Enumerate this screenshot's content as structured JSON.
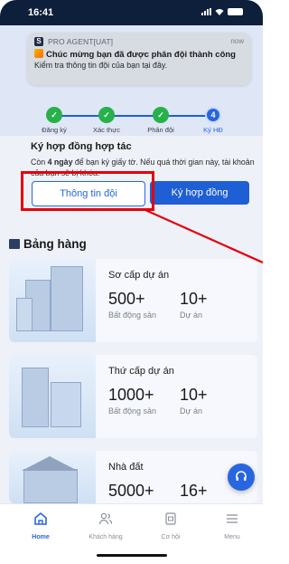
{
  "status_bar": {
    "time": "16:41"
  },
  "notification": {
    "app_name": "PRO AGENT[UAT]",
    "time": "now",
    "title": "Chúc mừng bạn đã được phân đội thành công",
    "body": "Kiểm tra thông tin đội của bạn tại đây."
  },
  "steps": [
    {
      "label": "Đăng ký",
      "state": "done"
    },
    {
      "label": "Xác thực",
      "state": "done"
    },
    {
      "label": "Phân đội",
      "state": "done"
    },
    {
      "label": "Ký HĐ",
      "state": "active",
      "number": "4"
    }
  ],
  "contract_card": {
    "heading": "Ký hợp đồng hợp tác",
    "desc_prefix": "Còn ",
    "desc_days": "4 ngày",
    "desc_suffix": " để bạn ký giấy tờ. Nếu quá thời gian này, tài khoản của bạn sẽ bị khóa.",
    "team_button": "Thông tin đội",
    "sign_button": "Ký hợp đồng"
  },
  "leaderboard": {
    "title": "Bảng hàng",
    "items": [
      {
        "name": "Sơ cấp dự án",
        "value1": "500+",
        "label1": "Bất động sản",
        "value2": "10+",
        "label2": "Dự án"
      },
      {
        "name": "Thứ cấp dự án",
        "value1": "1000+",
        "label1": "Bất động sản",
        "value2": "10+",
        "label2": "Dự án"
      },
      {
        "name": "Nhà đất",
        "value1": "5000+",
        "label1": "Bất động sản",
        "value2": "16+",
        "label2": "Dự án"
      }
    ]
  },
  "bottom_nav": [
    {
      "label": "Home",
      "icon": "home-icon",
      "active": true
    },
    {
      "label": "Khách hàng",
      "icon": "users-icon",
      "active": false
    },
    {
      "label": "Cơ hội",
      "icon": "opportunity-icon",
      "active": false
    },
    {
      "label": "Menu",
      "icon": "menu-icon",
      "active": false
    }
  ],
  "colors": {
    "primary": "#1f5fd6",
    "success": "#27b14a",
    "highlight": "#e5000b"
  }
}
